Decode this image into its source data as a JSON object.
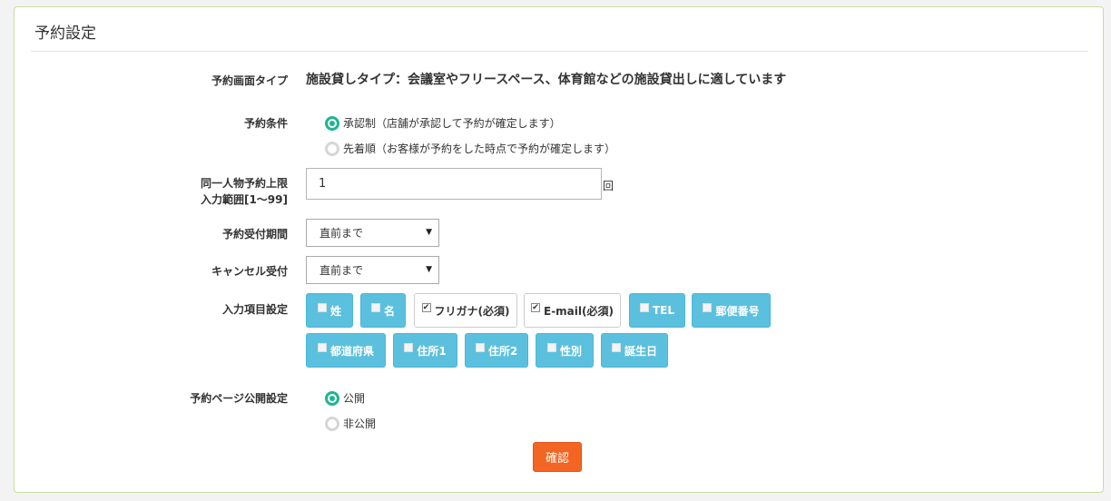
{
  "panel": {
    "title": "予約設定"
  },
  "fields": {
    "type": {
      "label": "予約画面タイプ",
      "value": "施設貸しタイプ：会議室やフリースペース、体育館などの施設貸出しに適しています"
    },
    "condition": {
      "label": "予約条件",
      "options": [
        {
          "text": "承認制（店舗が承認して予約が確定します）",
          "selected": true
        },
        {
          "text": "先着順（お客様が予約をした時点で予約が確定します）",
          "selected": false
        }
      ]
    },
    "limit": {
      "label_line1": "同一人物予約上限",
      "label_line2": "入力範囲[1〜99]",
      "value": "1",
      "unit": "回"
    },
    "period": {
      "label": "予約受付期間",
      "selected": "直前まで"
    },
    "cancel": {
      "label": "キャンセル受付",
      "selected": "直前まで"
    },
    "input_items": {
      "label": "入力項目設定",
      "items": [
        {
          "text": "姓",
          "checked": false
        },
        {
          "text": "名",
          "checked": false
        },
        {
          "text": "フリガナ(必須)",
          "checked": true
        },
        {
          "text": "E-mail(必須)",
          "checked": true
        },
        {
          "text": "TEL",
          "checked": false
        },
        {
          "text": "郵便番号",
          "checked": false
        },
        {
          "text": "都道府県",
          "checked": false
        },
        {
          "text": "住所1",
          "checked": false
        },
        {
          "text": "住所2",
          "checked": false
        },
        {
          "text": "性別",
          "checked": false
        },
        {
          "text": "誕生日",
          "checked": false
        }
      ]
    },
    "publish": {
      "label": "予約ページ公開設定",
      "options": [
        {
          "text": "公開",
          "selected": true
        },
        {
          "text": "非公開",
          "selected": false
        }
      ]
    }
  },
  "actions": {
    "confirm_label": "確認"
  },
  "colors": {
    "accent_green": "#1fb58f",
    "chip_blue": "#5bc0de",
    "button_orange": "#f26522"
  }
}
